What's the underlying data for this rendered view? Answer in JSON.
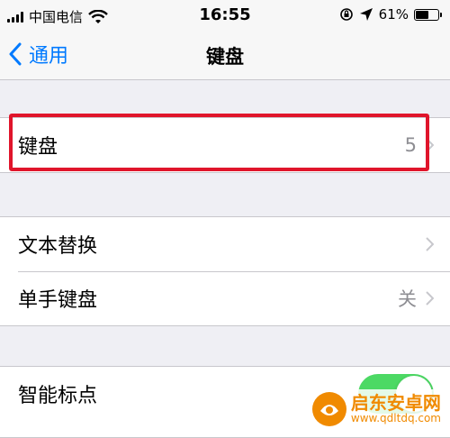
{
  "status_bar": {
    "carrier": "中国电信",
    "time": "16:55",
    "battery_percent_label": "61%",
    "battery_level": 0.61,
    "icons": [
      "signal-icon",
      "wifi-icon",
      "rotation-lock-icon",
      "location-icon",
      "battery-icon"
    ]
  },
  "nav": {
    "back_label": "通用",
    "title": "键盘"
  },
  "sections": {
    "keyboards": {
      "label": "键盘",
      "value": "5"
    },
    "text_replacement": {
      "label": "文本替换"
    },
    "one_handed": {
      "label": "单手键盘",
      "value": "关"
    },
    "smart_punctuation": {
      "label": "智能标点",
      "on": true
    }
  },
  "colors": {
    "accent": "#007aff",
    "highlight": "#e0152b",
    "toggle_on": "#4cd964",
    "background": "#efeff4"
  },
  "watermark": {
    "brand": "启东安卓网",
    "url": "www.qdltdq.com"
  }
}
